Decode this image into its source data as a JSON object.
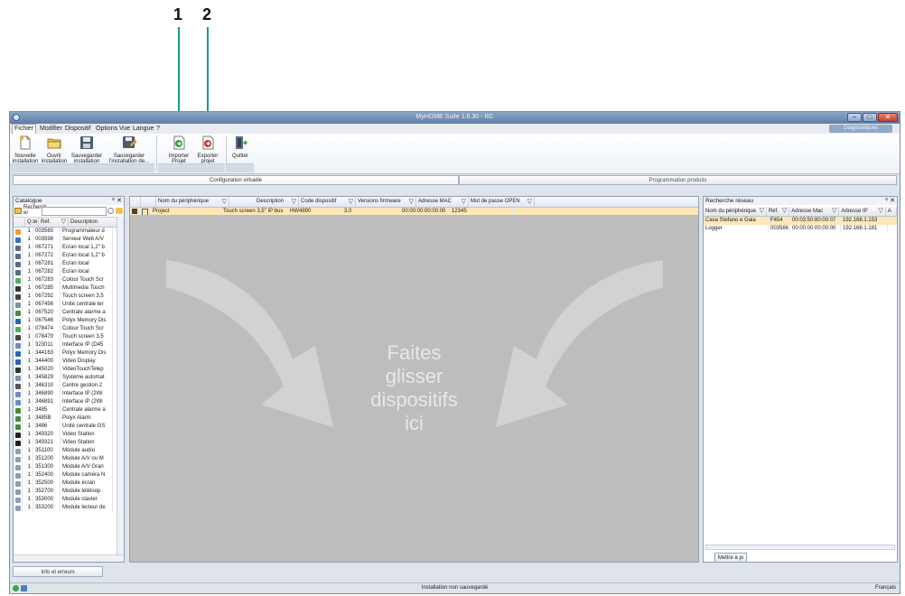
{
  "callouts": [
    "1",
    "2"
  ],
  "window": {
    "title": "MyHOME Suite 1.6.30 - RC"
  },
  "menu": [
    "Fichier",
    "Modifier",
    "Dispositif",
    "Options",
    "Vue",
    "Langue",
    "?"
  ],
  "diagnostic_label": "Diagnostiques",
  "ribbon": {
    "buttons": [
      {
        "line1": "Nouvelle",
        "line2": "installation",
        "icon": "new-file-icon"
      },
      {
        "line1": "Ouvrir",
        "line2": "installation",
        "icon": "open-folder-icon"
      },
      {
        "line1": "Sauvegarder",
        "line2": "installation",
        "icon": "save-icon"
      },
      {
        "line1": "Sauvegarder",
        "line2": "l'installation de...",
        "icon": "save-as-icon"
      },
      {
        "line1": "Importer",
        "line2": "Projet",
        "icon": "import-project-icon"
      },
      {
        "line1": "Exporter",
        "line2": "projet",
        "icon": "export-project-icon"
      },
      {
        "line1": "Quitter",
        "line2": "",
        "icon": "exit-icon"
      }
    ]
  },
  "tabs": [
    "Configuration virtuelle",
    "Programmation produits"
  ],
  "catalogue": {
    "title": "Catalogue",
    "pin": "&#x2C6;",
    "search_label": "Recherch er",
    "columns": [
      "Q.té",
      "Réf.",
      "Description"
    ],
    "items": [
      {
        "qty": "1",
        "ref": "003565",
        "desc": "Programmateur d"
      },
      {
        "qty": "1",
        "ref": "003598",
        "desc": "Serveur Web A/V"
      },
      {
        "qty": "1",
        "ref": "067271",
        "desc": "Écran local 1,2\" b"
      },
      {
        "qty": "1",
        "ref": "067272",
        "desc": "Écran local 1,2\" b"
      },
      {
        "qty": "1",
        "ref": "067281",
        "desc": "Écran local"
      },
      {
        "qty": "1",
        "ref": "067282",
        "desc": "Écran local"
      },
      {
        "qty": "1",
        "ref": "067283",
        "desc": "Colour Touch Scr"
      },
      {
        "qty": "1",
        "ref": "067285",
        "desc": "Multimedia Touch"
      },
      {
        "qty": "1",
        "ref": "067292",
        "desc": "Touch screen 3,5"
      },
      {
        "qty": "1",
        "ref": "067456",
        "desc": "Unité centrale ter"
      },
      {
        "qty": "1",
        "ref": "067520",
        "desc": "Centrale alarme a"
      },
      {
        "qty": "1",
        "ref": "067546",
        "desc": "Polyx Memory Dis"
      },
      {
        "qty": "1",
        "ref": "078474",
        "desc": "Colour Touch Scr"
      },
      {
        "qty": "1",
        "ref": "078479",
        "desc": "Touch screen 3,5"
      },
      {
        "qty": "1",
        "ref": "323011",
        "desc": "Interface IP (D45"
      },
      {
        "qty": "1",
        "ref": "344163",
        "desc": "Polyx Memory Dis"
      },
      {
        "qty": "1",
        "ref": "344400",
        "desc": "Video Display"
      },
      {
        "qty": "1",
        "ref": "345020",
        "desc": "VideoTouchTelep"
      },
      {
        "qty": "1",
        "ref": "345829",
        "desc": "Système automat"
      },
      {
        "qty": "1",
        "ref": "346310",
        "desc": "Centre gestion 2"
      },
      {
        "qty": "1",
        "ref": "346890",
        "desc": "Interface IP (2Wi"
      },
      {
        "qty": "1",
        "ref": "346891",
        "desc": "Interface IP (2Wi"
      },
      {
        "qty": "1",
        "ref": "3485",
        "desc": "Centrale alarme a"
      },
      {
        "qty": "1",
        "ref": "3485B",
        "desc": "Polyx Alarm"
      },
      {
        "qty": "1",
        "ref": "3486",
        "desc": "Unité centrale GS"
      },
      {
        "qty": "1",
        "ref": "349320",
        "desc": "Video Station"
      },
      {
        "qty": "1",
        "ref": "349321",
        "desc": "Video Station"
      },
      {
        "qty": "1",
        "ref": "351100",
        "desc": "Module audio"
      },
      {
        "qty": "1",
        "ref": "351200",
        "desc": "Module A/V ou M"
      },
      {
        "qty": "1",
        "ref": "351300",
        "desc": "Module A/V Gran"
      },
      {
        "qty": "1",
        "ref": "352400",
        "desc": "Module caméra N"
      },
      {
        "qty": "1",
        "ref": "352500",
        "desc": "Module écran"
      },
      {
        "qty": "1",
        "ref": "352700",
        "desc": "Module téléloop"
      },
      {
        "qty": "1",
        "ref": "353000",
        "desc": "Module clavier"
      },
      {
        "qty": "1",
        "ref": "353200",
        "desc": "Module lecteur de"
      }
    ]
  },
  "project_grid": {
    "columns": [
      "Nom du périphérique",
      "Description",
      "Code dispositif",
      "Versions firmware",
      "Adresse MAC",
      "Mot de passe OPEN"
    ],
    "rows": [
      {
        "name": "Project",
        "desc": "Touch screen 3,5\" IP bus",
        "code": "HW4890",
        "fw": "3.0",
        "mac": "00:00:00:00:00:00",
        "pwd": "12345"
      }
    ]
  },
  "drop_text": [
    "Faites",
    "glisser",
    "dispositifs",
    "ici"
  ],
  "network": {
    "title": "Recherche réseau",
    "columns": [
      "Nom du périphérique",
      "Réf.",
      "Adresse Mac",
      "Adresse IP",
      "A"
    ],
    "rows": [
      {
        "name": "Casa Stefano e Gaia",
        "ref": "F454",
        "mac": "00:03:50:80:00:07",
        "ip": "192.168.1.153"
      },
      {
        "name": "Logger",
        "ref": "003566",
        "mac": "00:00:00:00:00:00",
        "ip": "192.168.1.181"
      }
    ],
    "update_button": "Mettre à jo"
  },
  "info_tab": "Info et erreurs",
  "status": {
    "center": "Installation non sauvegardé",
    "language": "Français"
  },
  "colors": {
    "callout_line": "#1a9a8c",
    "selected_row": "#fde7b8",
    "dropzone": "#bdbdbd"
  }
}
